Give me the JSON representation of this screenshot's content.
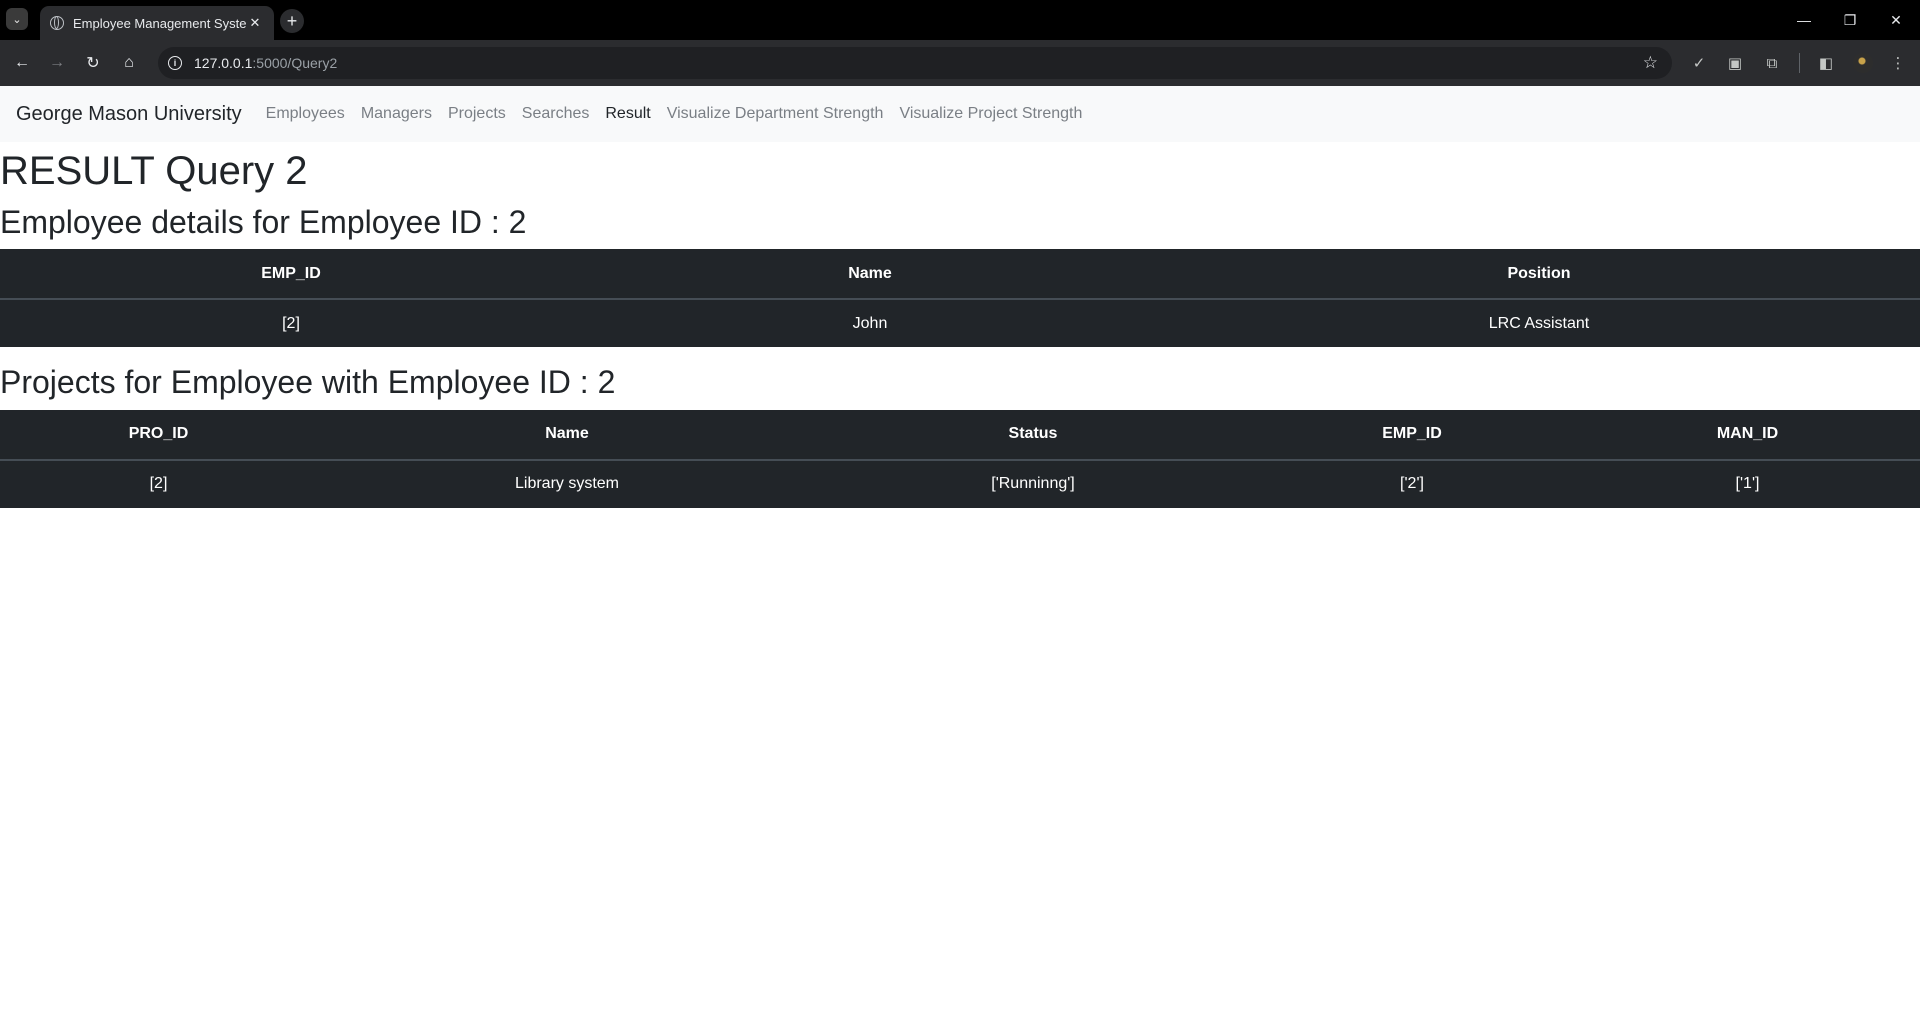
{
  "browser": {
    "tab_title": "Employee Management System",
    "tab_close": "✕",
    "new_tab": "+",
    "tab_search": "⌄",
    "url_host": "127.0.0.1",
    "url_path": ":5000/Query2",
    "window_controls": {
      "minimize": "—",
      "restore": "❐",
      "close": "✕"
    },
    "nav_buttons": {
      "back": "←",
      "forward": "→",
      "reload": "↻",
      "home": "⌂"
    },
    "bookmark_star": "☆",
    "info_glyph": "i"
  },
  "navbar": {
    "brand": "George Mason University",
    "links": [
      {
        "label": "Employees",
        "active": false
      },
      {
        "label": "Managers",
        "active": false
      },
      {
        "label": "Projects",
        "active": false
      },
      {
        "label": "Searches",
        "active": false
      },
      {
        "label": "Result",
        "active": true
      },
      {
        "label": "Visualize Department Strength",
        "active": false
      },
      {
        "label": "Visualize Project Strength",
        "active": false
      }
    ]
  },
  "page": {
    "title": "RESULT Query 2",
    "employee_heading": "Employee details for Employee ID : 2",
    "projects_heading": "Projects for Employee with Employee ID : 2"
  },
  "employee_table": {
    "headers": [
      "EMP_ID",
      "Name",
      "Position"
    ],
    "rows": [
      [
        "[2]",
        "John",
        "LRC Assistant"
      ]
    ]
  },
  "projects_table": {
    "headers": [
      "PRO_ID",
      "Name",
      "Status",
      "EMP_ID",
      "MAN_ID"
    ],
    "rows": [
      [
        "[2]",
        "Library system",
        "['Runninng']",
        "['2']",
        "['1']"
      ]
    ]
  },
  "colors": {
    "table_bg": "#212529",
    "navbar_bg": "#f8f9fa",
    "browser_toolbar": "#2b2c2f"
  }
}
